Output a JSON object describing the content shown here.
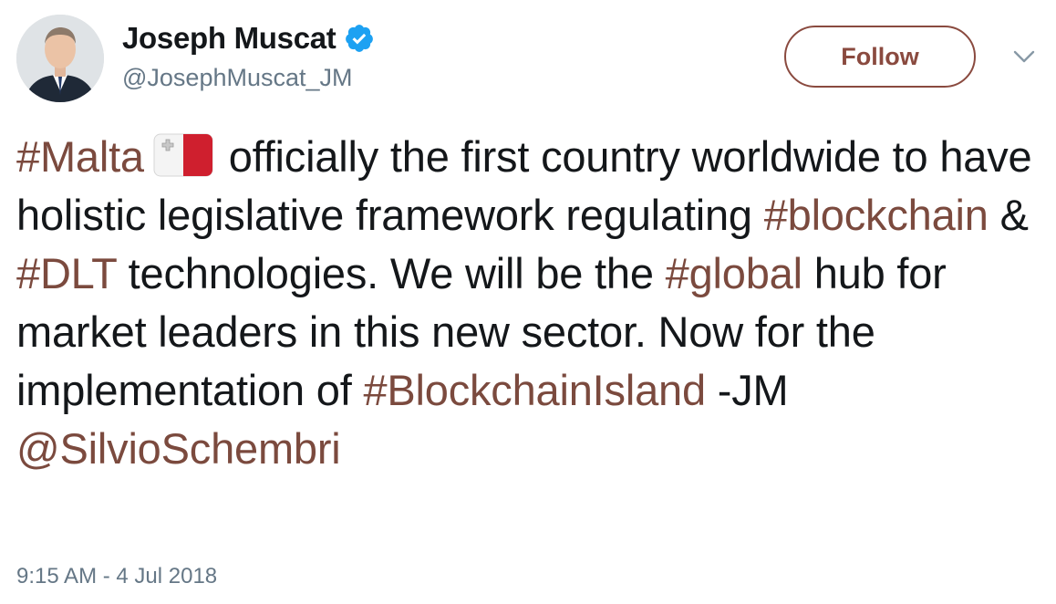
{
  "author": {
    "display_name": "Joseph Muscat",
    "handle": "@JosephMuscat_JM",
    "verified": true
  },
  "follow_button": {
    "label": "Follow"
  },
  "menu": {
    "icon": "chevron-down-icon"
  },
  "tweet": {
    "segments": [
      {
        "type": "hashtag",
        "text": "#Malta"
      },
      {
        "type": "emoji",
        "name": "malta-flag-icon"
      },
      {
        "type": "text",
        "text": " officially the first country worldwide to have holistic legislative framework regulating "
      },
      {
        "type": "hashtag",
        "text": "#blockchain"
      },
      {
        "type": "text",
        "text": " & "
      },
      {
        "type": "hashtag",
        "text": "#DLT"
      },
      {
        "type": "text",
        "text": " technologies. We will be the "
      },
      {
        "type": "hashtag",
        "text": "#global"
      },
      {
        "type": "text",
        "text": " hub for market leaders in this new sector. Now for the implementation of "
      },
      {
        "type": "hashtag",
        "text": "#BlockchainIsland"
      },
      {
        "type": "text",
        "text": " -JM "
      },
      {
        "type": "mention",
        "text": "@SilvioSchembri"
      }
    ]
  },
  "timestamp": "9:15 AM - 4 Jul 2018",
  "colors": {
    "link": "#7b4a3e",
    "follow_border": "#8a4a3f",
    "verified_badge": "#1da1f2",
    "secondary_text": "#657786"
  }
}
